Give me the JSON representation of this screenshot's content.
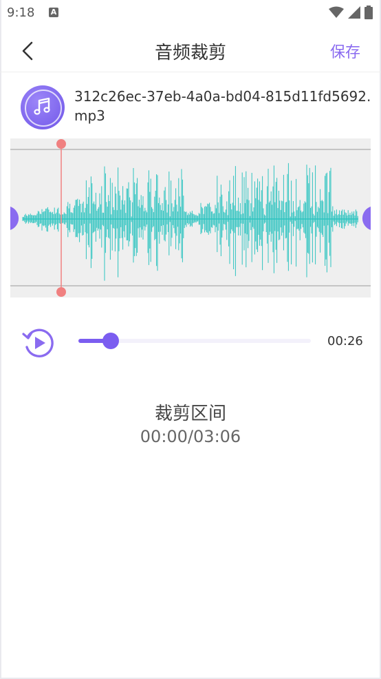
{
  "status": {
    "time": "9:18",
    "notification_icon": "A",
    "icons": [
      "wifi-icon",
      "signal-icon",
      "battery-icon"
    ]
  },
  "header": {
    "title": "音频裁剪",
    "save_label": "保存",
    "back_icon": "chevron-left-icon"
  },
  "file": {
    "name": "312c26ec-37eb-4a0a-bd04-815d11fd5692.mp3",
    "icon": "music-note-icon"
  },
  "player": {
    "play_icon": "replay-play-icon",
    "current_time": "00:26",
    "progress_fraction": 0.14
  },
  "range": {
    "label": "裁剪区间",
    "value": "00:00/03:06"
  },
  "colors": {
    "accent": "#7b5df0",
    "save": "#8a6bf0",
    "waveform": "#2ec4c0",
    "playhead": "#f08080"
  }
}
